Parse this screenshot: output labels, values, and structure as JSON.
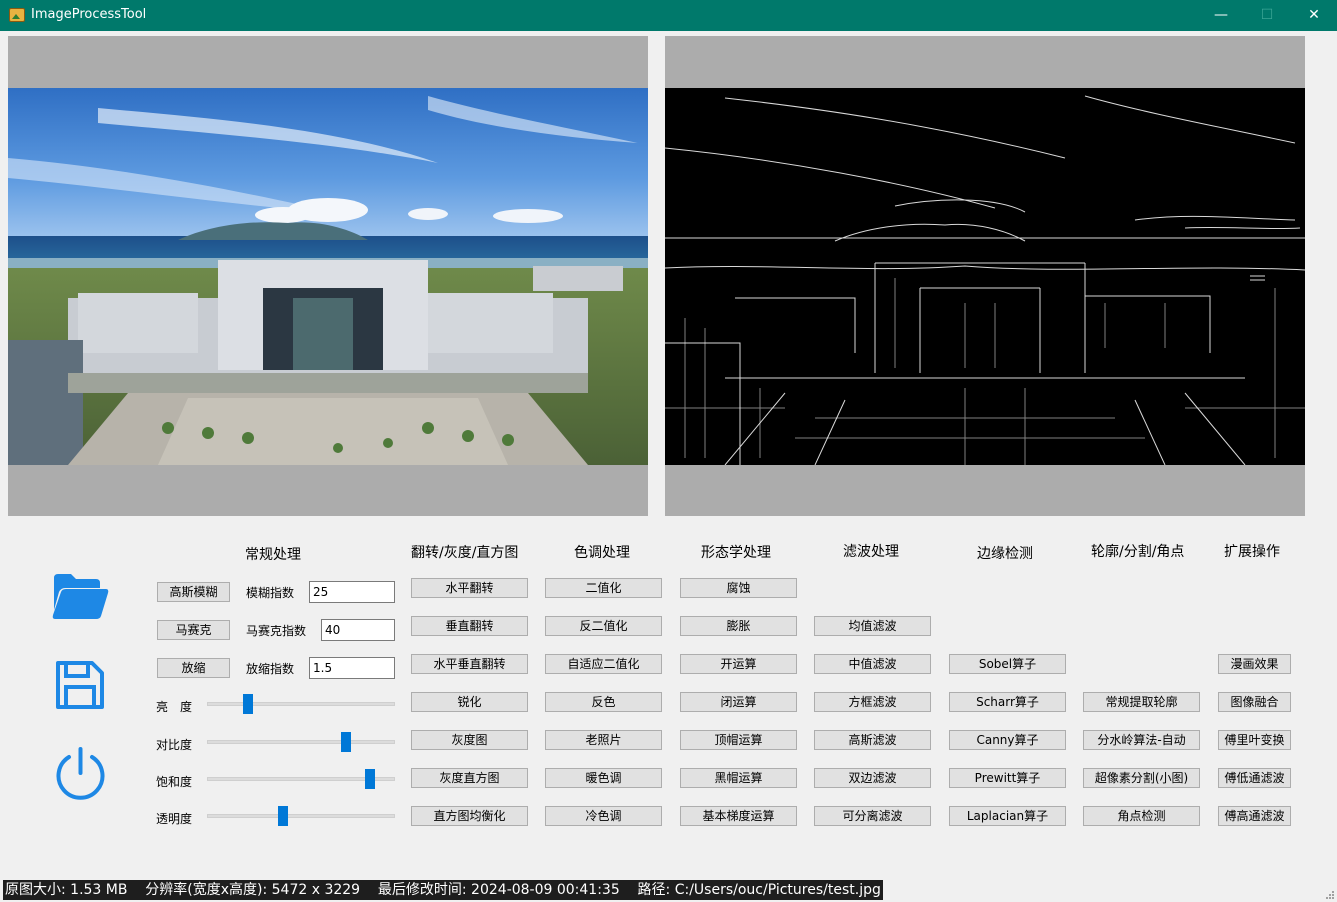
{
  "window": {
    "title": "ImageProcessTool",
    "controls": {
      "minimize": "—",
      "maximize": "☐",
      "close": "✕"
    }
  },
  "sections": {
    "general": "常规处理",
    "flip": "翻转/灰度/直方图",
    "tone": "色调处理",
    "morph": "形态学处理",
    "filter": "滤波处理",
    "edge": "边缘检测",
    "contour": "轮廓/分割/角点",
    "ext": "扩展操作"
  },
  "general": {
    "blur_button": "高斯模糊",
    "blur_label": "模糊指数",
    "blur_value": "25",
    "mosaic_button": "马赛克",
    "mosaic_label": "马赛克指数",
    "mosaic_value": "40",
    "scale_button": "放缩",
    "scale_label": "放缩指数",
    "scale_value": "1.5"
  },
  "sliders": [
    {
      "label": "亮　度",
      "value": 0.2
    },
    {
      "label": "对比度",
      "value": 0.75
    },
    {
      "label": "饱和度",
      "value": 0.89
    },
    {
      "label": "透明度",
      "value": 0.4
    }
  ],
  "flip_buttons": [
    "水平翻转",
    "垂直翻转",
    "水平垂直翻转",
    "锐化",
    "灰度图",
    "灰度直方图",
    "直方图均衡化"
  ],
  "tone_buttons": [
    "二值化",
    "反二值化",
    "自适应二值化",
    "反色",
    "老照片",
    "暖色调",
    "冷色调"
  ],
  "morph_buttons": [
    "腐蚀",
    "膨胀",
    "开运算",
    "闭运算",
    "顶帽运算",
    "黑帽运算",
    "基本梯度运算"
  ],
  "filter_buttons": [
    "均值滤波",
    "中值滤波",
    "方框滤波",
    "高斯滤波",
    "双边滤波",
    "可分离滤波"
  ],
  "edge_buttons": [
    "Sobel算子",
    "Scharr算子",
    "Canny算子",
    "Prewitt算子",
    "Laplacian算子"
  ],
  "contour_buttons": [
    "常规提取轮廓",
    "分水岭算法-自动",
    "超像素分割(小图)",
    "角点检测"
  ],
  "ext_buttons": [
    "漫画效果",
    "图像融合",
    "傅里叶变换",
    "傅低通滤波",
    "傅高通滤波"
  ],
  "icons": {
    "open": "folder-icon",
    "save": "save-icon",
    "exit": "power-icon"
  },
  "status": {
    "text": "原图大小: 1.53 MB    分辨率(宽度x高度): 5472 x 3229    最后修改时间: 2024-08-09 00:41:35    路径: C:/Users/ouc/Pictures/test.jpg"
  },
  "colors": {
    "titlebar": "#00796b",
    "accent": "#0078d7",
    "panel": "#acacac"
  }
}
